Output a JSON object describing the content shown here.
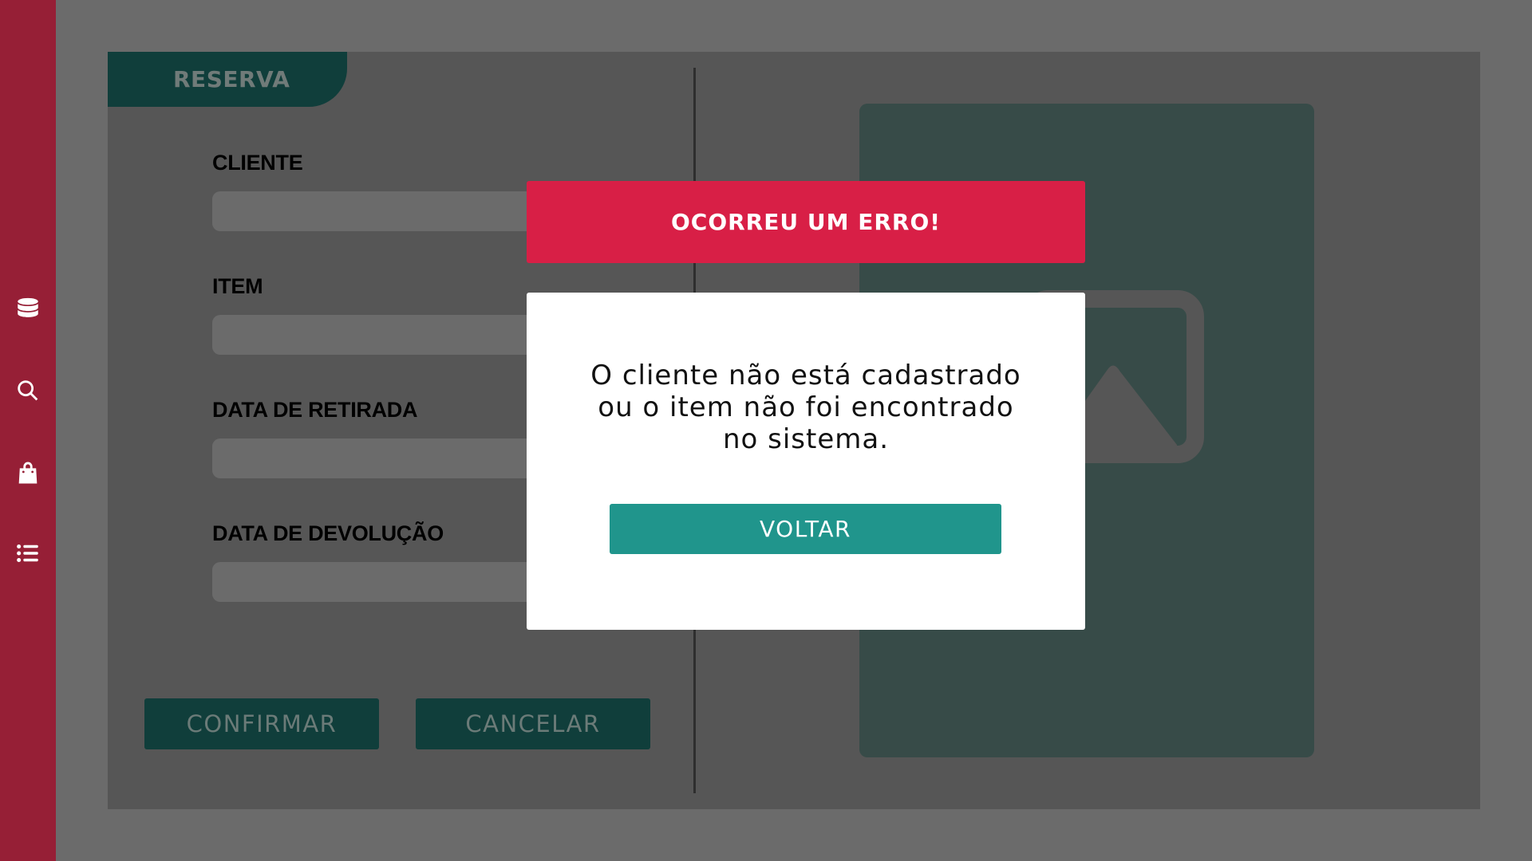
{
  "sidebar": {
    "items": [
      {
        "icon": "database-icon"
      },
      {
        "icon": "search-icon"
      },
      {
        "icon": "shopping-bag-icon"
      },
      {
        "icon": "list-icon"
      }
    ],
    "color": "#961f36"
  },
  "form": {
    "tab_label": "RESERVA",
    "fields": [
      {
        "label": "CLIENTE",
        "value": ""
      },
      {
        "label": "ITEM",
        "value": ""
      },
      {
        "label": "DATA DE RETIRADA",
        "value": ""
      },
      {
        "label": "DATA DE DEVOLUÇÃO",
        "value": ""
      }
    ],
    "confirm_label": "CONFIRMAR",
    "cancel_label": "CANCELAR",
    "image_placeholder_icon": "image-icon"
  },
  "modal": {
    "title": "OCORREU UM ERRO!",
    "message_lines": [
      "O cliente não está cadastrado",
      "ou o item não foi encontrado",
      "no sistema."
    ],
    "button_label": "VOLTAR",
    "colors": {
      "header": "#d81f46",
      "button": "#20958c"
    }
  }
}
